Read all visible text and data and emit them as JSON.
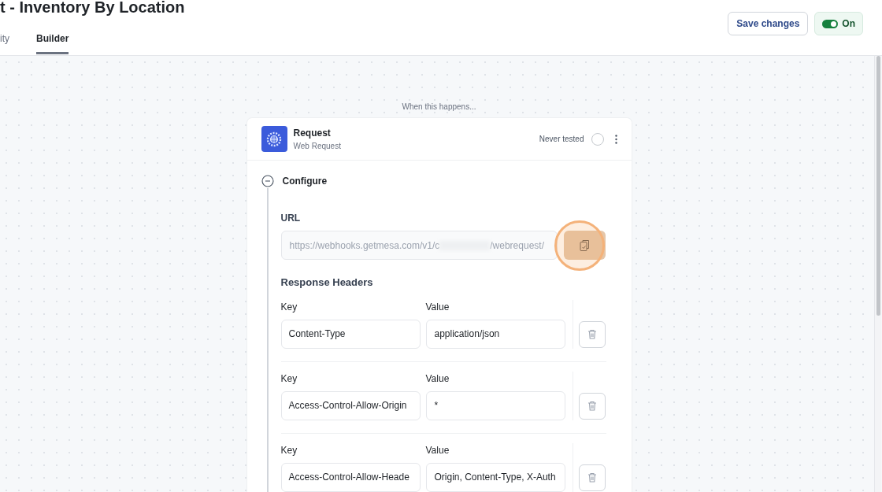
{
  "header": {
    "title": "t - Inventory By Location",
    "tabs": [
      {
        "label": "ity",
        "selected": false
      },
      {
        "label": "Builder",
        "selected": true
      }
    ],
    "save_button": "Save changes",
    "toggle": {
      "label": "On",
      "on": true
    }
  },
  "canvas": {
    "trigger_caption": "When this happens...",
    "card": {
      "title": "Request",
      "subtitle": "Web Request",
      "status": "Never tested",
      "section": {
        "title": "Configure",
        "expanded": true
      },
      "url": {
        "label": "URL",
        "value_start": "https://webhooks.getmesa.com/v1/c",
        "value_end": "/webrequest/"
      },
      "headers_title": "Response Headers",
      "headers": [
        {
          "key_label": "Key",
          "value_label": "Value",
          "key": "Content-Type",
          "value": "application/json"
        },
        {
          "key_label": "Key",
          "value_label": "Value",
          "key": "Access-Control-Allow-Origin",
          "value": "*"
        },
        {
          "key_label": "Key",
          "value_label": "Value",
          "key": "Access-Control-Allow-Heade",
          "value": "Origin, Content-Type, X-Auth"
        }
      ]
    }
  }
}
